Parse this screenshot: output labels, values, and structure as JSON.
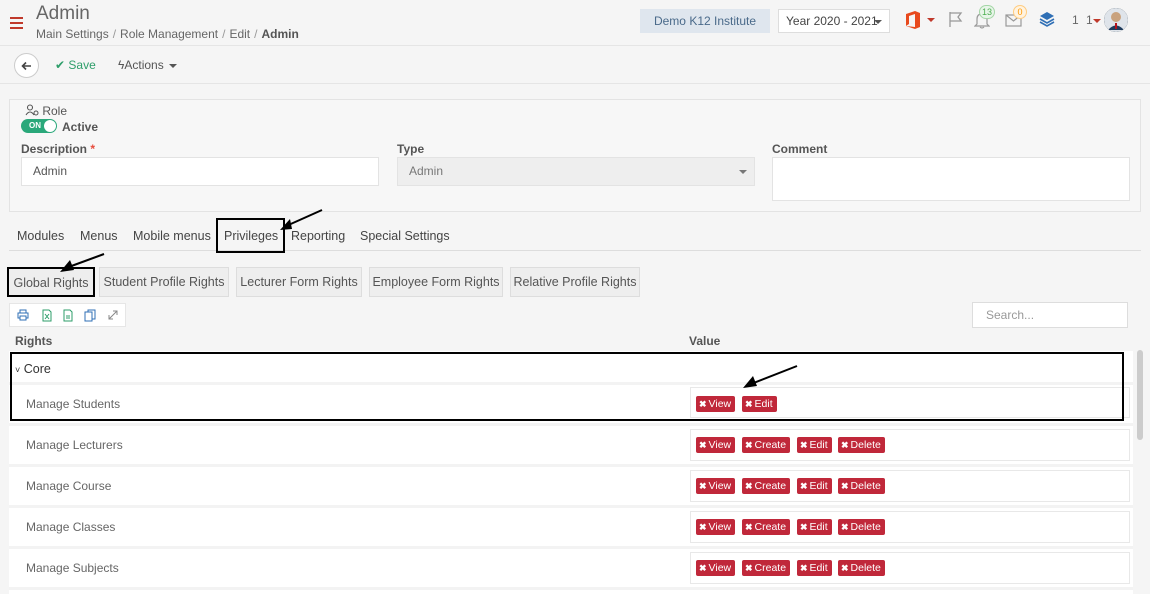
{
  "header": {
    "title": "Admin",
    "breadcrumb": [
      "Main Settings",
      "Role Management",
      "Edit",
      "Admin"
    ],
    "institute": "Demo K12 Institute",
    "year": "Year 2020 - 2021",
    "notifications_count": "13",
    "messages_count": "0",
    "user_name": "1 1"
  },
  "toolbar": {
    "save_label": "Save",
    "actions_label": "Actions"
  },
  "role": {
    "section_label": "Role",
    "toggle_label": "ON",
    "active_label": "Active",
    "description_label": "Description",
    "required_mark": "*",
    "description_value": "Admin",
    "type_label": "Type",
    "type_value": "Admin",
    "comment_label": "Comment",
    "comment_value": ""
  },
  "tabs": [
    "Modules",
    "Menus",
    "Mobile menus",
    "Privileges",
    "Reporting",
    "Special Settings"
  ],
  "active_tab": "Privileges",
  "subtabs": [
    "Global Rights",
    "Student Profile Rights",
    "Lecturer Form Rights",
    "Employee Form Rights",
    "Relative Profile Rights"
  ],
  "active_subtab": "Global Rights",
  "search": {
    "placeholder": "Search..."
  },
  "table": {
    "col_rights": "Rights",
    "col_value": "Value",
    "group": "Core",
    "rows": [
      {
        "label": "Manage Students",
        "chips": [
          "View",
          "Edit"
        ]
      },
      {
        "label": "Manage Lecturers",
        "chips": [
          "View",
          "Create",
          "Edit",
          "Delete"
        ]
      },
      {
        "label": "Manage Course",
        "chips": [
          "View",
          "Create",
          "Edit",
          "Delete"
        ]
      },
      {
        "label": "Manage Classes",
        "chips": [
          "View",
          "Create",
          "Edit",
          "Delete"
        ]
      },
      {
        "label": "Manage Subjects",
        "chips": [
          "View",
          "Create",
          "Edit",
          "Delete"
        ]
      }
    ]
  },
  "colors": {
    "accent_red": "#c0283a",
    "save_green": "#2e9e6a",
    "toggle_green": "#2aa87a"
  }
}
